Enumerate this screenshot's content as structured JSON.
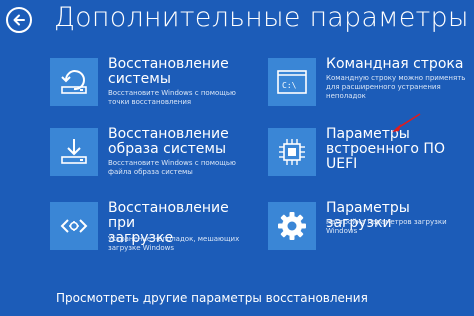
{
  "header": {
    "title": "Дополнительные параметры"
  },
  "options": [
    {
      "id": "system-restore",
      "icon": "restore-icon",
      "title": "Восстановление\nсистемы",
      "description": "Восстановите Windows с помощью\nточки восстановления"
    },
    {
      "id": "command-prompt",
      "icon": "command-prompt-icon",
      "title": "Командная строка",
      "description": "Командную строку можно применять\nдля расширенного устранения\nнеполадок"
    },
    {
      "id": "system-image-recovery",
      "icon": "image-recovery-icon",
      "title": "Восстановление\nобраза системы",
      "description": "Восстановите Windows с помощью\nфайла образа системы"
    },
    {
      "id": "uefi-firmware",
      "icon": "chip-icon",
      "title": "Параметры\nвстроенного ПО\nUEFI",
      "description": ""
    },
    {
      "id": "startup-repair",
      "icon": "startup-repair-icon",
      "title": "Восстановление при\nзагрузке",
      "description": "Устранение неполадок, мешающих\nзагрузке Windows"
    },
    {
      "id": "startup-settings",
      "icon": "gear-icon",
      "title": "Параметры загрузки",
      "description": "Настройка параметров загрузки\nWindows"
    }
  ],
  "footer": {
    "more_link": "Просмотреть другие параметры восстановления"
  },
  "colors": {
    "background": "#1c5cb8",
    "tile": "#3a86d6",
    "arrow": "#e21b1b"
  }
}
